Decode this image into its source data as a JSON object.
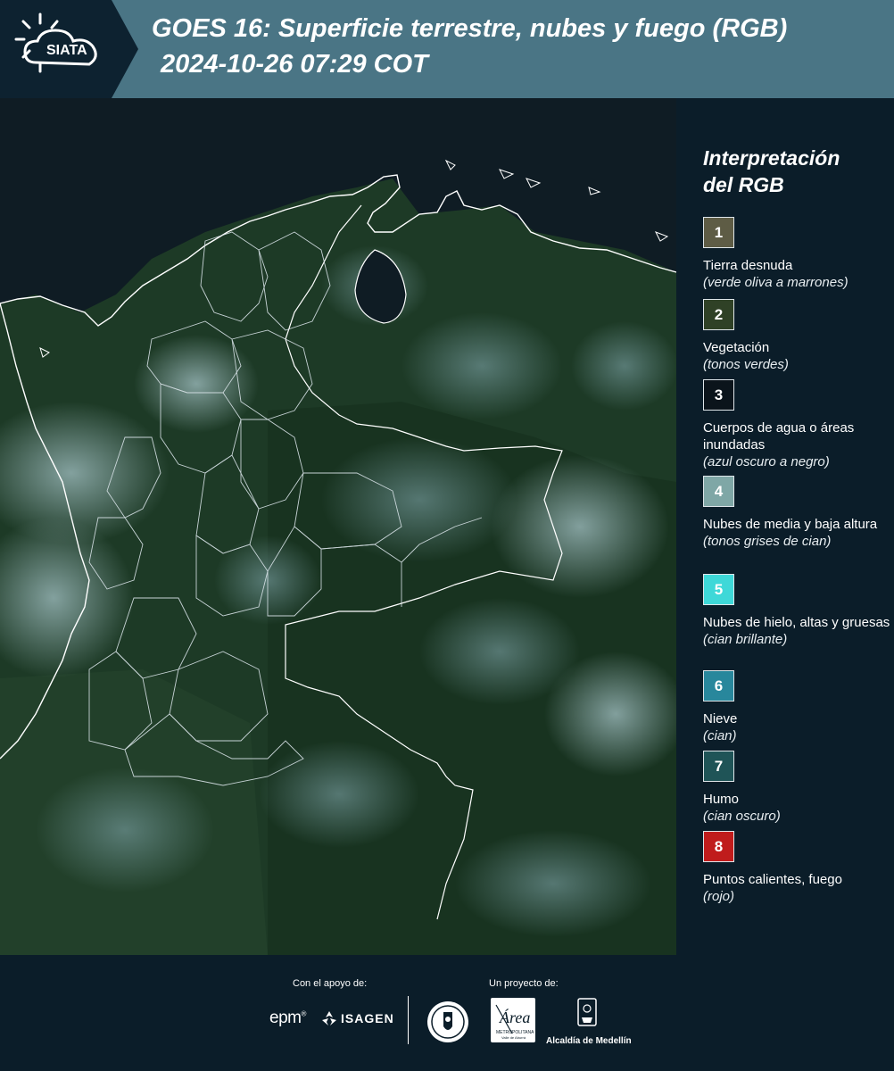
{
  "header": {
    "logo_text": "SIATA",
    "title": "GOES 16: Superficie terrestre, nubes y fuego (RGB)",
    "subtitle": "2024-10-26 07:29 COT",
    "background": "#4a7585"
  },
  "legend": {
    "title_line1": "Interpretación",
    "title_line2": "del RGB",
    "items": [
      {
        "number": "1",
        "label": "Tierra desnuda",
        "desc": "(verde oliva a marrones)",
        "color": "#5e5c45"
      },
      {
        "number": "2",
        "label": "Vegetación",
        "desc": "(tonos verdes)",
        "color": "#2f4126"
      },
      {
        "number": "3",
        "label": "Cuerpos de agua o áreas inundadas",
        "desc": "(azul oscuro a negro)",
        "color": "#0b141b"
      },
      {
        "number": "4",
        "label": "Nubes de media y baja altura",
        "desc": "(tonos grises de cian)",
        "color": "#7fa7a6"
      },
      {
        "number": "5",
        "label": "Nubes de hielo, altas y gruesas",
        "desc": "(cian brillante)",
        "color": "#3ed8d8"
      },
      {
        "number": "6",
        "label": "Nieve",
        "desc": "(cian)",
        "color": "#28879c"
      },
      {
        "number": "7",
        "label": "Humo",
        "desc": "(cian oscuro)",
        "color": "#1f5457"
      },
      {
        "number": "8",
        "label": "Puntos calientes, fuego",
        "desc": "(rojo)",
        "color": "#c01c1c"
      }
    ]
  },
  "footer": {
    "support_label": "Con el apoyo de:",
    "project_label": "Un proyecto de:",
    "sponsor_epm": "epm",
    "sponsor_isagen": "ISAGEN",
    "area_logo_text": "Área METROPOLITANA Valle de Aburrá",
    "alcaldia": "Alcaldía de Medellín"
  }
}
